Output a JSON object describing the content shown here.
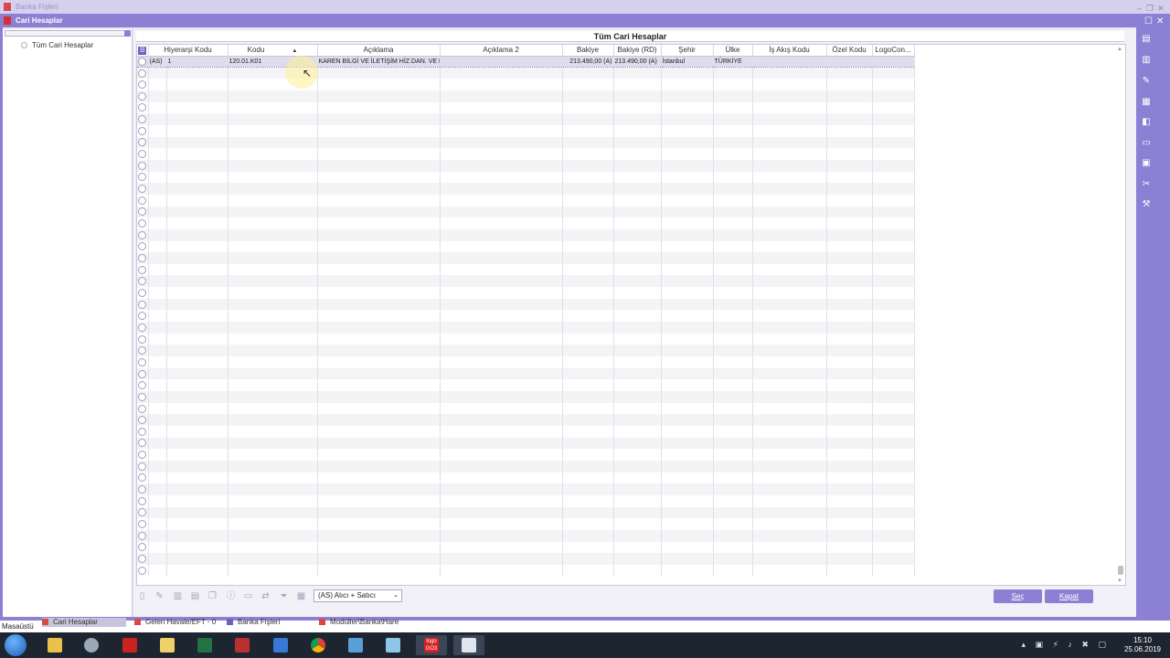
{
  "window": {
    "outer_title": "Banka Fişleri",
    "inner_title": "Cari Hesaplar"
  },
  "tree": {
    "root_label": "Tüm Cari Hesaplar"
  },
  "grid": {
    "title": "Tüm Cari Hesaplar",
    "columns": [
      "Hiyerarşi Kodu",
      "Kodu",
      "Açıklama",
      "Açıklama 2",
      "Bakiye",
      "Bakiye (RD)",
      "Şehir",
      "Ülke",
      "İş Akış Kodu",
      "Özel Kodu",
      "LogoCon..."
    ],
    "rows": [
      {
        "type": "(AS)",
        "hierarchy": "1",
        "code": "120.01.K01",
        "description": "KAREN BİLGİ VE İLETİŞİM HİZ.DAN. VE D",
        "description2": "",
        "balance": "213.490,00 (A)",
        "balance_rd": "213.490,00 (A)",
        "city": "İstanbul",
        "country": "TÜRKİYE",
        "workflow": "",
        "special": "",
        "logocon": ""
      }
    ],
    "empty_rows": 44
  },
  "toolbar": {
    "filter_value": "(AS) Alıcı + Satıcı",
    "select_button": "Seç",
    "close_button": "Kapat"
  },
  "tabs": {
    "desktop_label": "Masaüstü",
    "items": [
      "Cari Hesaplar",
      "Gelen Havale/EFT - 0",
      "Banka Fişleri",
      "Modüller\\Banka\\Hare"
    ]
  },
  "taskbar": {
    "logo_label": "logo GO3",
    "time": "15:10",
    "date": "25.06.2019"
  },
  "colors": {
    "accent": "#8b80d4",
    "taskbar": "#1d2530"
  }
}
